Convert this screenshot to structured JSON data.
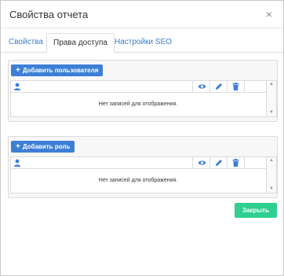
{
  "dialog": {
    "title": "Свойства отчета",
    "close_symbol": "×"
  },
  "tabs": [
    {
      "label": "Свойства",
      "active": false
    },
    {
      "label": "Права доступа",
      "active": true
    },
    {
      "label": "Настройки SEO",
      "active": false
    }
  ],
  "users_section": {
    "add_button": "Добавить пользователя",
    "empty_text": "Нет записей для отображения."
  },
  "roles_section": {
    "add_button": "Добавить роль",
    "empty_text": "Нет записей для отображения."
  },
  "footer": {
    "close_button": "Закрыть"
  },
  "colors": {
    "primary": "#3d7fd6",
    "success": "#2fd08f",
    "link": "#3a7dc9"
  },
  "icons": {
    "column_user": "user-icon",
    "column_view": "eye-icon",
    "column_edit": "pencil-icon",
    "column_delete": "trash-icon"
  }
}
